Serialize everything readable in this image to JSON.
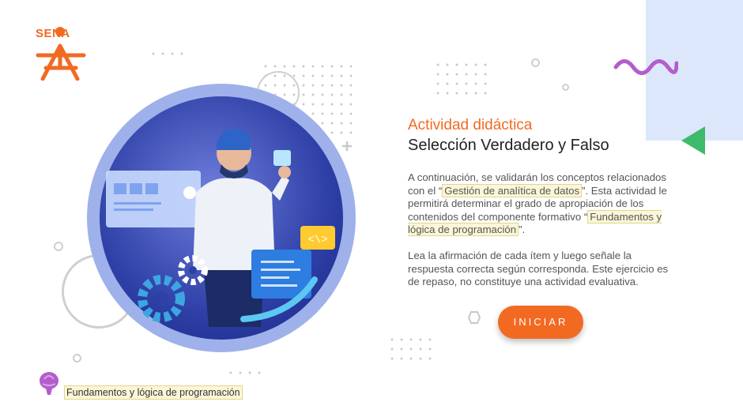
{
  "brand": {
    "logo_text": "SENA",
    "accent": "#f26a22",
    "green": "#3dbb6a",
    "purple": "#b35dcc",
    "panel": "#dde7fb"
  },
  "content": {
    "title": "Actividad didáctica",
    "subtitle": "Selección Verdadero y Falso",
    "p1_before": "A continuación, se validarán los conceptos relacionados con el “",
    "p1_hl1": "Gestión de analítica de datos",
    "p1_mid": "”. Esta actividad le permitirá determinar el grado de apropiación de los contenidos del componente formativo “",
    "p1_hl2": "Fundamentos y lógica de programación",
    "p1_after": "”.",
    "p2": "Lea la afirmación de cada ítem y luego señale la respuesta correcta según corresponda. Este ejercicio es de repaso, no constituye una actividad evaluativa."
  },
  "actions": {
    "start_label": "INICIAR"
  },
  "footer": {
    "component_label": "Fundamentos y lógica de programación"
  },
  "icons": [
    "sena-logo-icon",
    "illustration-developer",
    "wave-icon",
    "triangle-icon",
    "brain-icon",
    "code-icon",
    "gear-icon"
  ]
}
